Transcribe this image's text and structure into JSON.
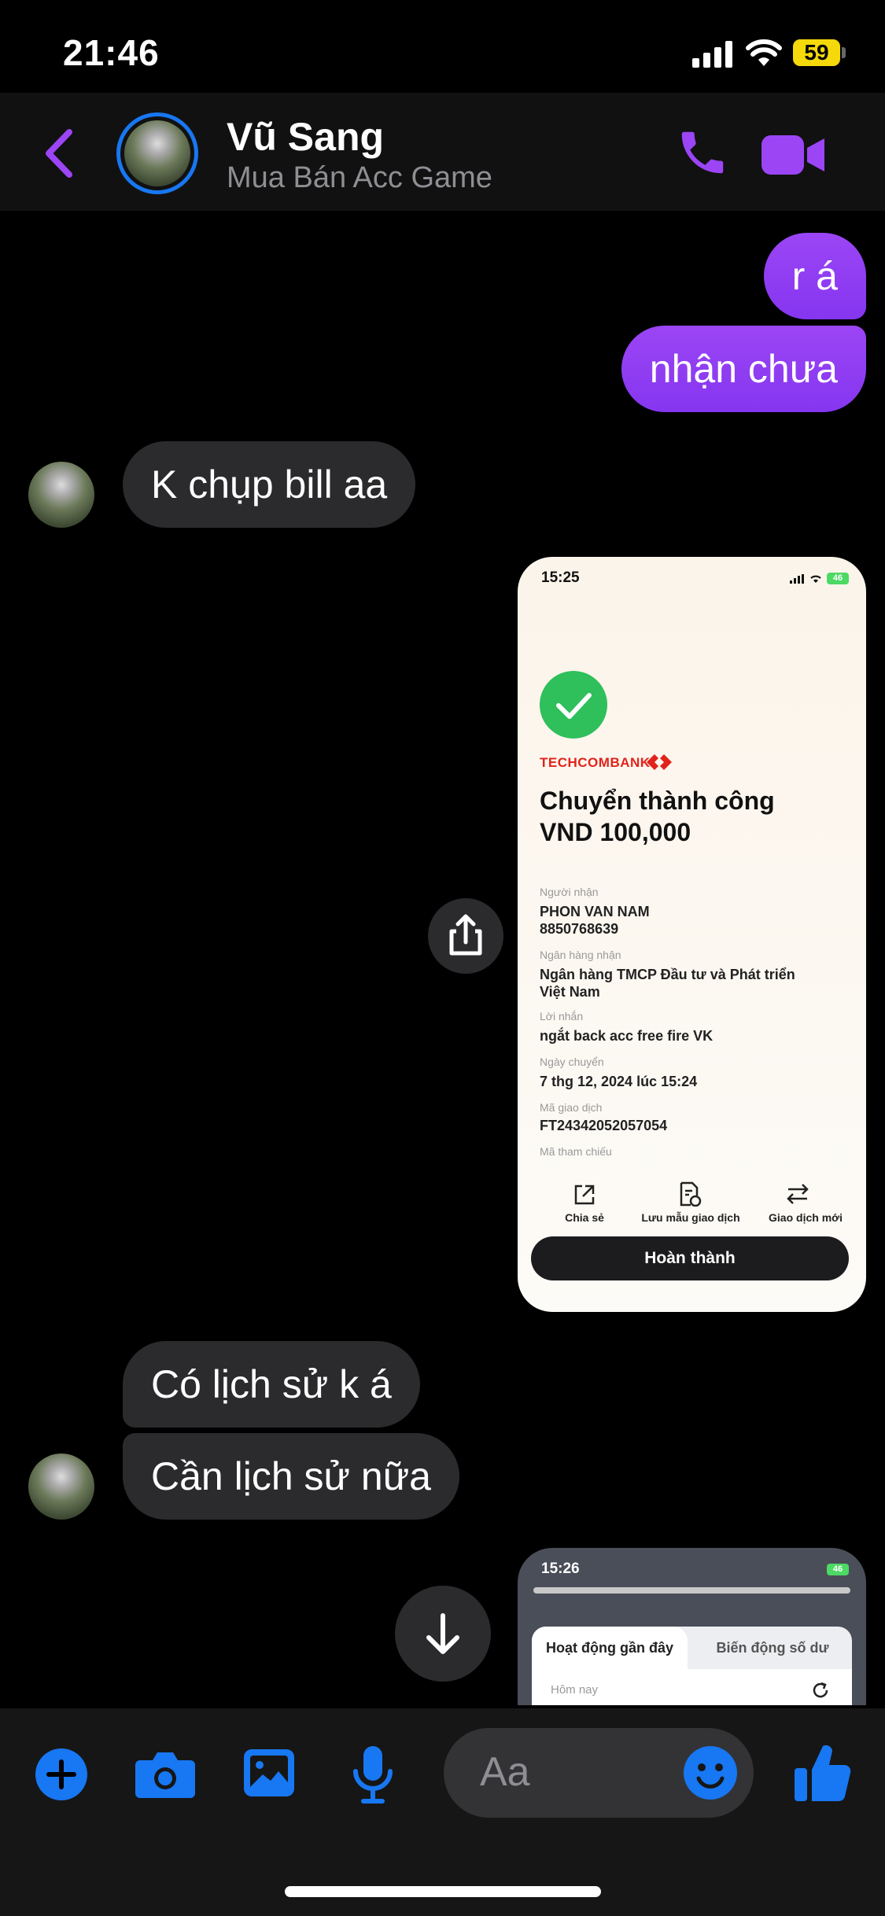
{
  "status_bar": {
    "time": "21:46",
    "battery": "59"
  },
  "header": {
    "name": "Vũ Sang",
    "subtitle": "Mua Bán Acc Game"
  },
  "messages": {
    "out1": "r á",
    "out2": "nhận chưa",
    "in1": "K chụp bill aa",
    "in2": "Có lịch sử k á",
    "in3": "Cần lịch sử nữa"
  },
  "receipt": {
    "time": "15:25",
    "battery": "46",
    "bank": "TECHCOMBANK",
    "title_line1": "Chuyển thành công",
    "title_line2": "VND 100,000",
    "fields": [
      {
        "label": "Người nhận",
        "value": "PHON VAN NAM\n8850768639"
      },
      {
        "label": "Ngân hàng nhận",
        "value": "Ngân hàng TMCP Đầu tư và Phát triển\nViệt Nam"
      },
      {
        "label": "Lời nhắn",
        "value": "ngắt back acc free fire VK"
      },
      {
        "label": "Ngày chuyển",
        "value": "7 thg 12, 2024 lúc 15:24"
      },
      {
        "label": "Mã giao dịch",
        "value": "FT24342052057054"
      },
      {
        "label": "Mã tham chiếu",
        "value": ""
      }
    ],
    "actions": [
      "Chia sẻ",
      "Lưu mẫu giao dịch",
      "Giao dịch mới"
    ],
    "done_button": "Hoàn thành"
  },
  "image2": {
    "time": "15:26",
    "battery": "46",
    "tab_active": "Hoạt động gần đây",
    "tab_inactive": "Biến động số dư",
    "section": "Hôm nay"
  },
  "composer": {
    "placeholder": "Aa"
  },
  "colors": {
    "accent_purple": "#8a3ffc",
    "messenger_blue": "#1877f2",
    "incoming_bubble": "#2b2b2d",
    "techcombank_red": "#e2231a"
  }
}
